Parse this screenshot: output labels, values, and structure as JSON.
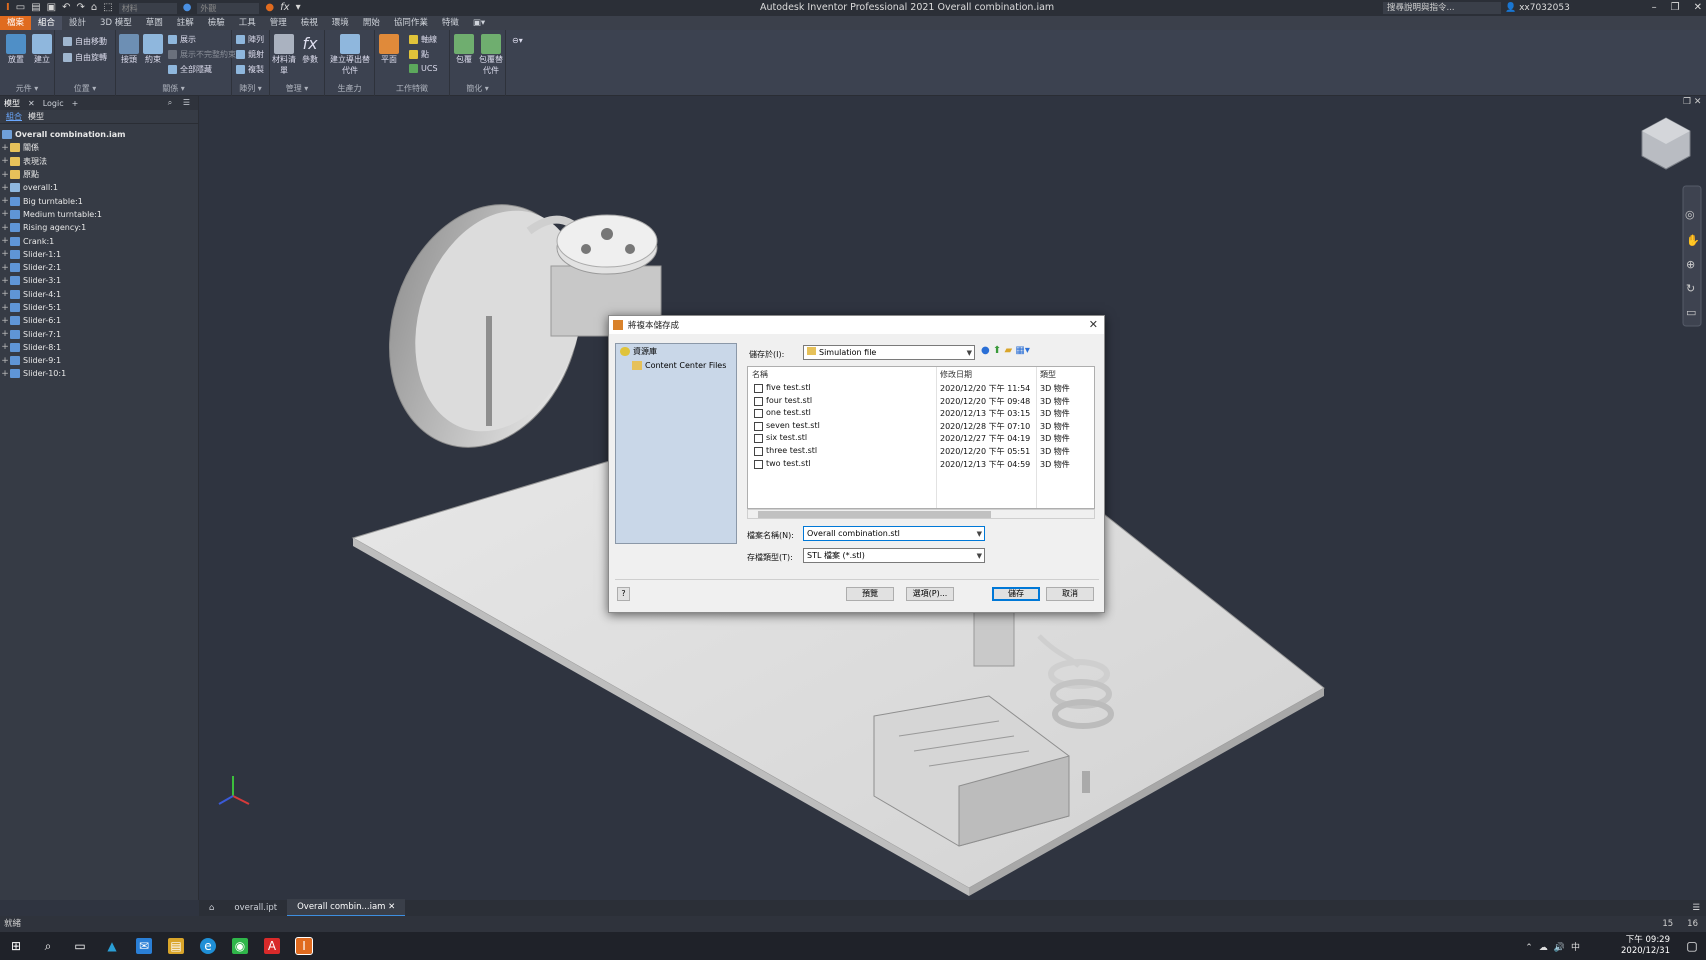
{
  "titlebar": {
    "app_title": "Autodesk Inventor Professional 2021    Overall combination.iam",
    "search_placeholder": "搜尋說明與指令...",
    "user": "xx7032053",
    "material_label": "材料",
    "appearance_label": "外觀"
  },
  "ribbon_tabs": [
    "檔案",
    "組合",
    "設計",
    "3D 模型",
    "草圖",
    "註解",
    "檢驗",
    "工具",
    "管理",
    "檢視",
    "環境",
    "開始",
    "協同作業",
    "特徵"
  ],
  "ribbon": {
    "groups": [
      {
        "label": "元件 ▾",
        "buttons": [
          "放置",
          "建立"
        ]
      },
      {
        "label": "位置 ▾",
        "buttons": [
          "自由移動",
          "自由旋轉"
        ]
      },
      {
        "label": "關係 ▾",
        "buttons": [
          "接頭",
          "約束",
          "展示",
          "展示不完整約束",
          "全部隱藏"
        ]
      },
      {
        "label": "陣列 ▾",
        "buttons": [
          "陣列",
          "鏡射",
          "複製"
        ]
      },
      {
        "label": "管理 ▾",
        "buttons": [
          "材料清單",
          "參數"
        ]
      },
      {
        "label": "生產力",
        "buttons": [
          "建立導出替代件"
        ]
      },
      {
        "label": "工作特徵",
        "buttons": [
          "平面",
          "軸線",
          "點",
          "UCS"
        ]
      },
      {
        "label": "簡化 ▾",
        "buttons": [
          "包覆",
          "包覆替代件"
        ]
      }
    ]
  },
  "browser": {
    "tabs": [
      "模型",
      "Logic"
    ],
    "subtabs": [
      "組合",
      "模型"
    ],
    "root": "Overall combination.iam",
    "items": [
      "關係",
      "表現法",
      "原點",
      "overall:1",
      "Big turntable:1",
      "Medium turntable:1",
      "Rising agency:1",
      "Crank:1",
      "Slider-1:1",
      "Slider-2:1",
      "Slider-3:1",
      "Slider-4:1",
      "Slider-5:1",
      "Slider-6:1",
      "Slider-7:1",
      "Slider-8:1",
      "Slider-9:1",
      "Slider-10:1"
    ]
  },
  "dialog": {
    "title": "將複本儲存成",
    "left_items": [
      "資源庫",
      "Content Center Files"
    ],
    "save_in_label": "儲存於(I):",
    "save_in_value": "Simulation file",
    "columns": [
      "名稱",
      "修改日期",
      "類型"
    ],
    "files": [
      {
        "name": "five test.stl",
        "date": "2020/12/20 下午 11:54",
        "type": "3D 物件"
      },
      {
        "name": "four test.stl",
        "date": "2020/12/20 下午 09:48",
        "type": "3D 物件"
      },
      {
        "name": "one test.stl",
        "date": "2020/12/13 下午 03:15",
        "type": "3D 物件"
      },
      {
        "name": "seven test.stl",
        "date": "2020/12/28 下午 07:10",
        "type": "3D 物件"
      },
      {
        "name": "six test.stl",
        "date": "2020/12/27 下午 04:19",
        "type": "3D 物件"
      },
      {
        "name": "three test.stl",
        "date": "2020/12/20 下午 05:51",
        "type": "3D 物件"
      },
      {
        "name": "two test.stl",
        "date": "2020/12/13 下午 04:59",
        "type": "3D 物件"
      }
    ],
    "filename_label": "檔案名稱(N):",
    "filename_value": "Overall combination.stl",
    "filetype_label": "存檔類型(T):",
    "filetype_value": "STL 檔案 (*.stl)",
    "preview_button": "預覽",
    "options_button": "選項(P)...",
    "save_button": "儲存",
    "cancel_button": "取消"
  },
  "doc_tabs": [
    "overall.ipt",
    "Overall combin...iam"
  ],
  "status": {
    "text": "就緒",
    "num1": "15",
    "num2": "16"
  },
  "taskbar": {
    "time": "下午 09:29",
    "date": "2020/12/31"
  }
}
